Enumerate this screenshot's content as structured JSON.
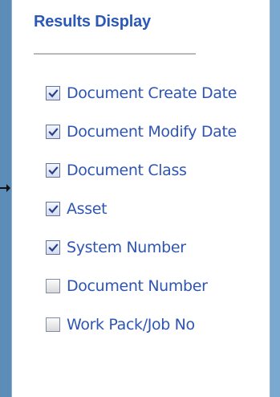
{
  "panel": {
    "title": "Results Display"
  },
  "options": [
    {
      "label": "Document Create Date",
      "checked": true
    },
    {
      "label": "Document Modify Date",
      "checked": true
    },
    {
      "label": "Document Class",
      "checked": true
    },
    {
      "label": "Asset",
      "checked": true
    },
    {
      "label": "System Number",
      "checked": true
    },
    {
      "label": "Document Number",
      "checked": false
    },
    {
      "label": "Work Pack/Job No",
      "checked": false
    }
  ],
  "colors": {
    "accent": "#2F55B3",
    "background_frame": "#6C9BC3",
    "panel": "#FFFFFF"
  },
  "icons": {
    "checkmark": "check-icon",
    "pointer": "arrow-pointer-icon"
  }
}
